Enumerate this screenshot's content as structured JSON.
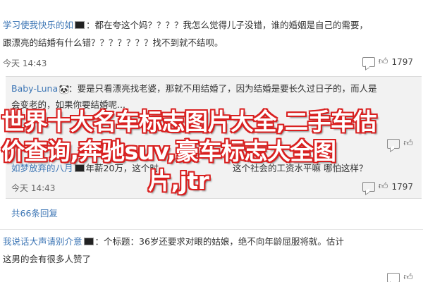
{
  "post1": {
    "user": "学习使我快乐的如",
    "line1": "：都在夸这个妈？？？？我怎么觉得儿子没错，谁的婚姻是自己的需要，",
    "line2": "跟漂亮的结婚有什么错？？？？？？？找不到就不结呗。",
    "time": "今天 14:43",
    "likes": "1797"
  },
  "post2": {
    "user": "Baby-Luna",
    "line1": "：要是只看漂亮找老婆，那就不用结婚了，因为结婚是要长久过日子的，而人是",
    "line2": "会变老的，如果你要结婚呢..."
  },
  "post3": {
    "user": "如梦放弃的八月",
    "line1": "年薪20万，这个时",
    "line2": "这个社会的工资水平嘛 哪怕这样？",
    "time": "今天 14:43",
    "likes": "1797"
  },
  "expand": {
    "label": "共66条回复"
  },
  "post4": {
    "user": "我说话大声请别介意",
    "line1": "：个标题：36岁还要求对眼的姑娘，绝不向年龄屈服将就。估计",
    "line2": "这男的会有很多人赞了"
  },
  "overlay": {
    "line1": "世界十大名车标志图片大全,二手车估",
    "line2": "价查询,奔驰suv,豪车标志大全图",
    "line3": "片,jtr"
  },
  "colors": {
    "username": "#3d76b5",
    "overlay_fill": "#ffffff",
    "overlay_stroke": "#d92020",
    "quote_bg": "#f2f2f2"
  },
  "icons": {
    "flag": "flag-icon",
    "panda": "panda-emoji-icon",
    "reply": "reply-icon",
    "like": "like-icon"
  }
}
